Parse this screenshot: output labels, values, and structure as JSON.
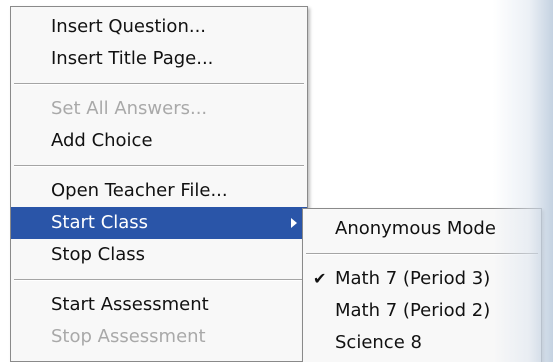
{
  "main_menu": {
    "items": [
      {
        "label": "Insert Question..."
      },
      {
        "label": "Insert Title Page..."
      },
      {
        "label": "Set All Answers..."
      },
      {
        "label": "Add Choice"
      },
      {
        "label": "Open Teacher File..."
      },
      {
        "label": "Start Class"
      },
      {
        "label": "Stop Class"
      },
      {
        "label": "Start Assessment"
      },
      {
        "label": "Stop Assessment"
      }
    ]
  },
  "sub_menu": {
    "items": [
      {
        "label": "Anonymous Mode"
      },
      {
        "label": "Math 7 (Period 3)"
      },
      {
        "label": "Math 7 (Period 2)"
      },
      {
        "label": "Science 8"
      }
    ],
    "check_glyph": "✔"
  },
  "colors": {
    "highlight": "#2a55a8",
    "disabled_text": "#a9a9a9",
    "text": "#111111",
    "menu_bg": "#f8f8f8"
  }
}
